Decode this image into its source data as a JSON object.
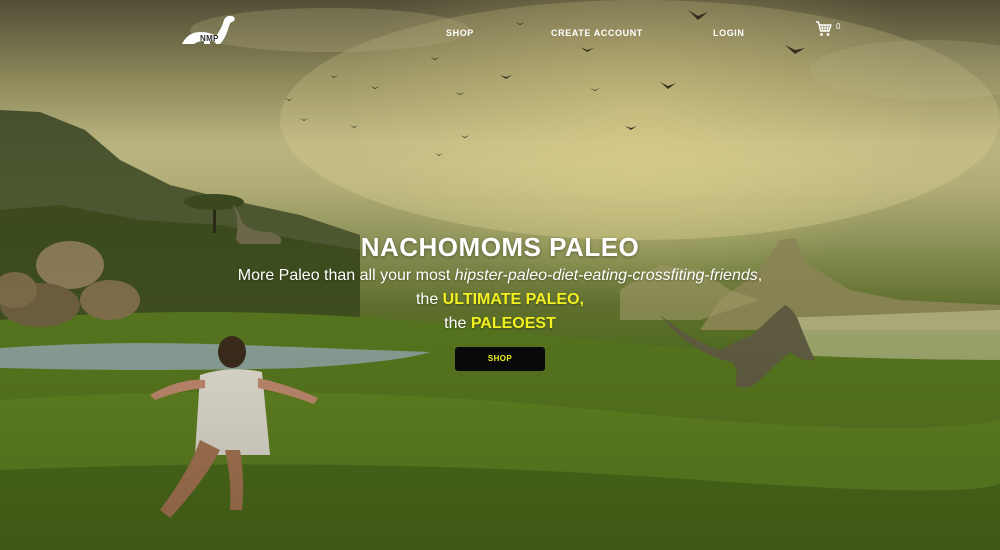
{
  "header": {
    "logo_text": "NMP",
    "nav": [
      {
        "label": "SHOP"
      },
      {
        "label": "CREATE ACCOUNT"
      },
      {
        "label": "LOGIN"
      }
    ],
    "cart_count": "0"
  },
  "hero": {
    "title": "NACHOMOMS PALEO",
    "line1_plain": "More Paleo than all your most ",
    "line1_italic": "hipster-paleo-diet-eating-crossfiting-friends",
    "line1_end": ",",
    "line2_plain": "the ",
    "line2_highlight": "ULTIMATE PALEO,",
    "line3_plain": "the ",
    "line3_highlight": "PALEOEST",
    "cta_label": "SHOP"
  },
  "colors": {
    "accent_yellow": "#f2f020",
    "button_bg": "#0a0a0a",
    "nav_text": "#ffffff"
  },
  "icons": [
    "dinosaur-logo-icon",
    "cart-icon"
  ]
}
